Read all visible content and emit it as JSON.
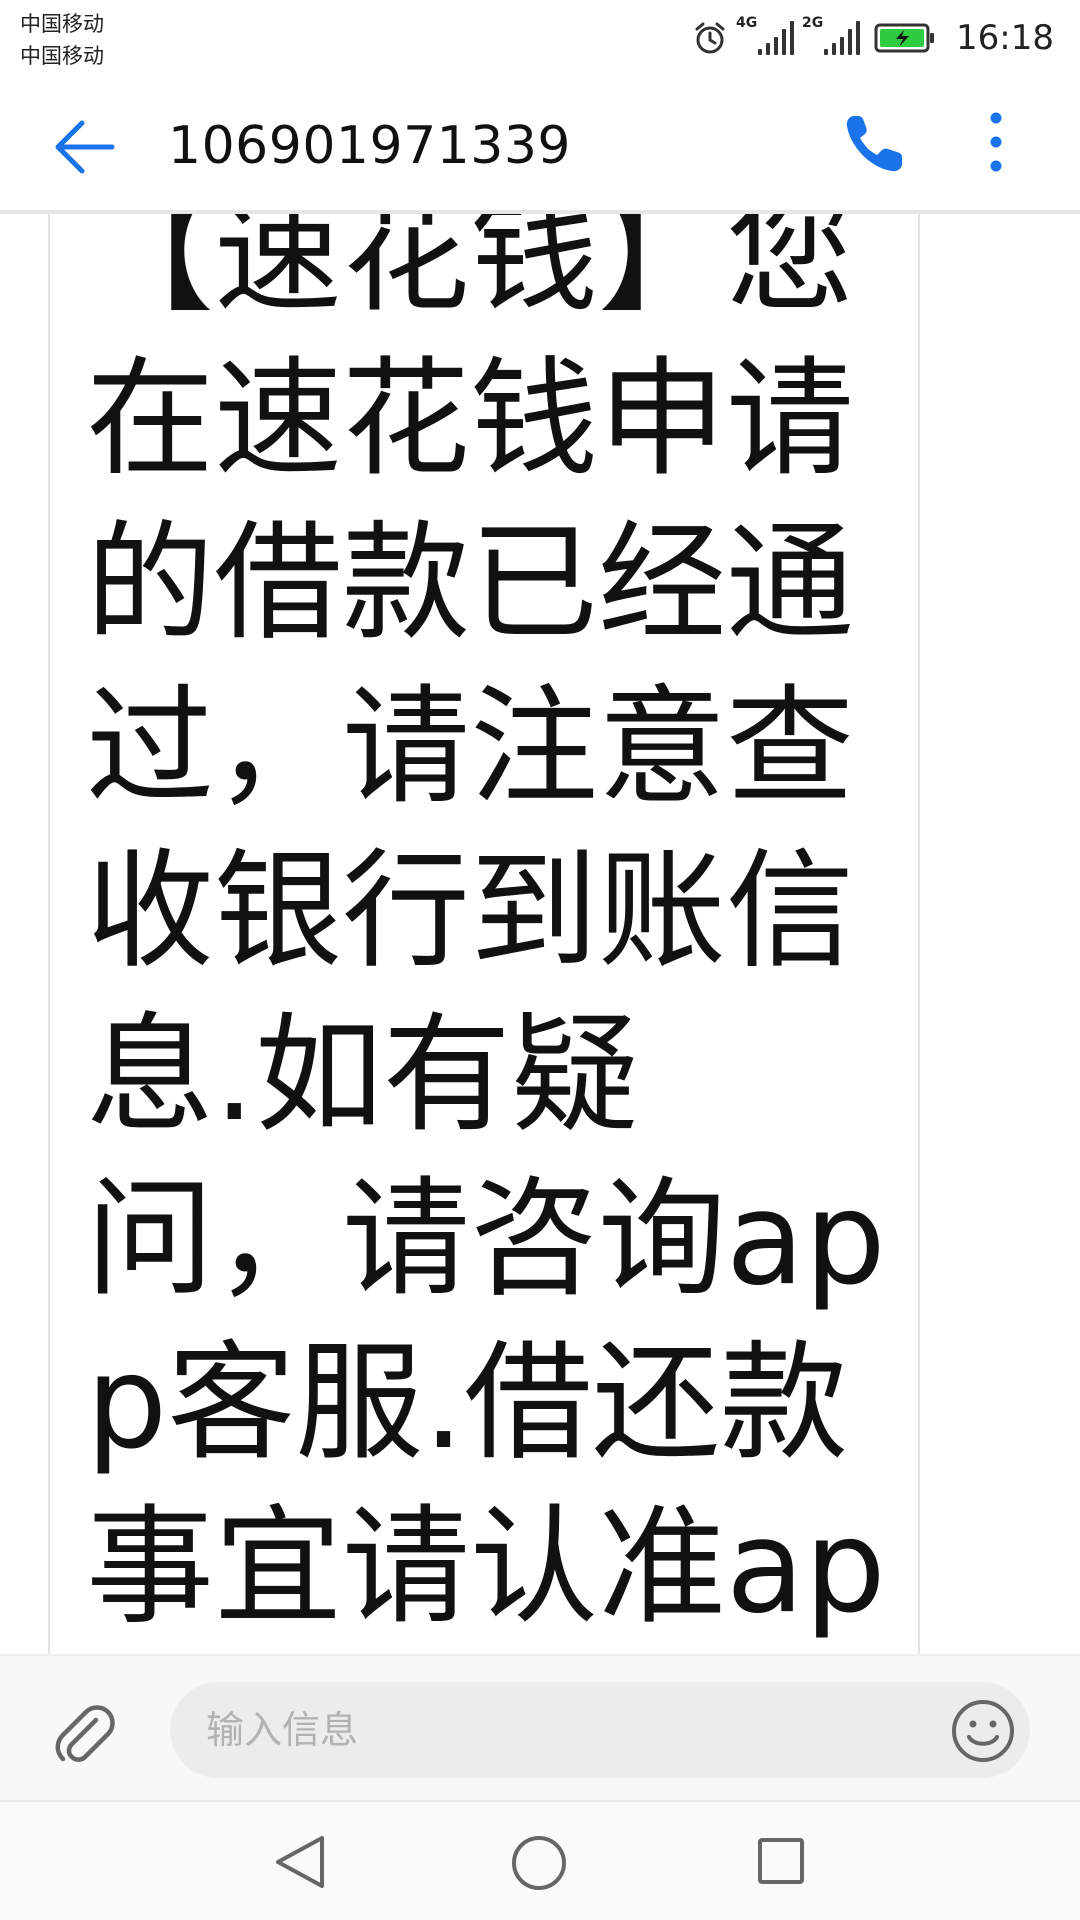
{
  "status_bar": {
    "carrier_1": "中国移动",
    "carrier_2": "中国移动",
    "signal_1_label": "4G",
    "signal_2_label": "2G",
    "time": "16:18",
    "battery_color": "#2ecc40"
  },
  "header": {
    "title": "106901971339",
    "accent_color": "#1a73e8",
    "icons": [
      "back-arrow-icon",
      "phone-icon",
      "more-vertical-icon"
    ]
  },
  "message": {
    "text": "【速花钱】您在速花钱申请的借款已经通过，请注意查收银行到账信息.如有疑问，请咨询app客服.借还款事宜请认准app客"
  },
  "composer": {
    "placeholder": "输入信息",
    "icons": [
      "paperclip-icon",
      "emoji-icon"
    ]
  },
  "nav_bar": {
    "icons": [
      "nav-back-icon",
      "nav-home-icon",
      "nav-recents-icon"
    ]
  }
}
